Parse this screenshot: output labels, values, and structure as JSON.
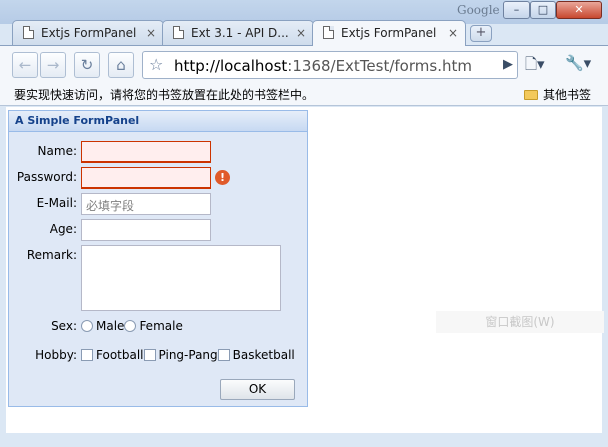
{
  "window": {
    "google_label": "Google",
    "minimize": "–",
    "maximize": "□",
    "close": "✕"
  },
  "tabs": [
    {
      "label": "Extjs FormPanel",
      "close": "×",
      "active": false
    },
    {
      "label": "Ext 3.1 - API D...",
      "close": "×",
      "active": false
    },
    {
      "label": "Extjs FormPanel",
      "close": "×",
      "active": true
    }
  ],
  "newtab": "+",
  "toolbar": {
    "back": "←",
    "forward": "→",
    "reload": "↻",
    "home": "⌂",
    "star": "☆",
    "url_host": "http://localhost",
    "url_rest": ":1368/ExtTest/forms.htm",
    "go": "▶",
    "page_menu": "🗋▾",
    "tool_menu": "🔧▾"
  },
  "bookmarks": {
    "hint": "要实现快速访问，请将您的书签放置在此处的书签栏中。",
    "other": "其他书签"
  },
  "watermark": "窗口截图(W)",
  "form": {
    "title": "A Simple FormPanel",
    "name_label": "Name:",
    "password_label": "Password:",
    "email_label": "E-Mail:",
    "email_placeholder": "必填字段",
    "age_label": "Age:",
    "remark_label": "Remark:",
    "sex_label": "Sex:",
    "sex_options": [
      "Male",
      "Female"
    ],
    "hobby_label": "Hobby:",
    "hobby_options": [
      "Football",
      "Ping-Pang",
      "Basketball"
    ],
    "error_icon": "!",
    "ok_label": "OK"
  }
}
